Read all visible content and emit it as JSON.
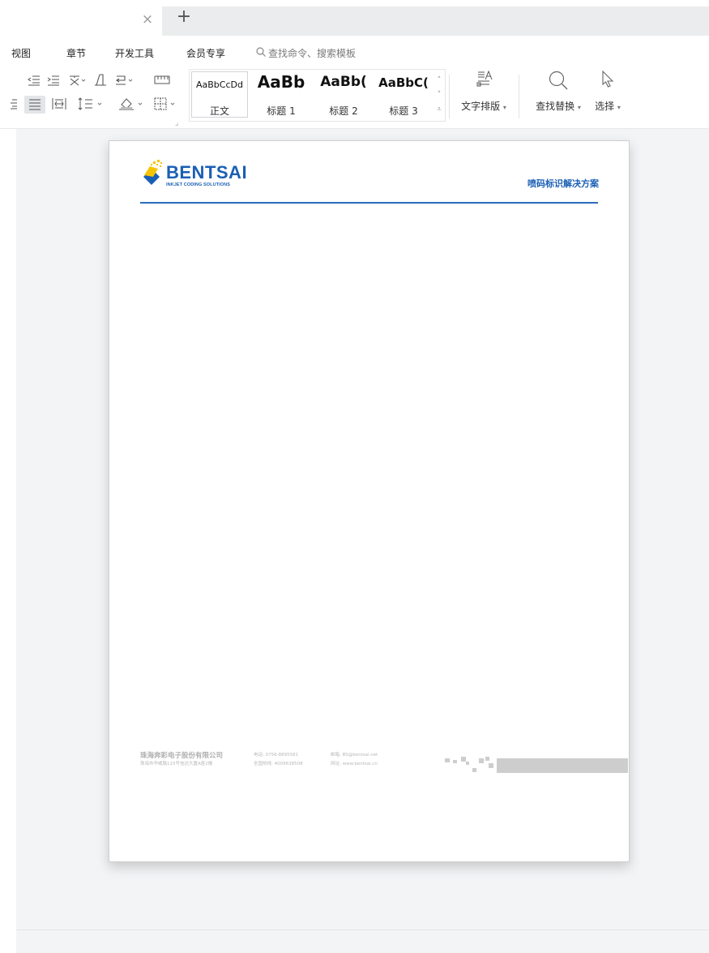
{
  "tabbar": {
    "close_glyph": "×",
    "add_glyph": "+"
  },
  "menu": {
    "items": [
      "视图",
      "章节",
      "开发工具",
      "会员专享"
    ],
    "search_placeholder": "查找命令、搜索模板"
  },
  "ribbon": {
    "style_gallery": [
      {
        "sample": "AaBbCcDd",
        "label": "正文"
      },
      {
        "sample": "AaBb",
        "label": "标题 1"
      },
      {
        "sample": "AaBb(",
        "label": "标题 2"
      },
      {
        "sample": "AaBbC(",
        "label": "标题 3"
      }
    ],
    "text_layout_label": "文字排版",
    "find_replace_label": "查找替换",
    "select_label": "选择",
    "dropdown_glyph": "▾"
  },
  "document": {
    "logo_text": "BENTSAI",
    "logo_tagline": "INKJET CODING SOLUTIONS",
    "header_right": "喷码标识解决方案",
    "footer": {
      "company": "珠海奔彩电子股份有限公司",
      "address": "珠海市华威路115号信达大厦A座2楼",
      "phone": "电话: 0756-8895581",
      "hotline": "全国热线: 4009638508",
      "email": "邮箱: BS@bentsai.net",
      "website": "网址: www.bentsai.cn"
    }
  },
  "colors": {
    "brand_blue": "#1a5fb4",
    "logo_yellow": "#f5c400",
    "workspace_bg": "#f3f4f6",
    "tab_strip_bg": "#ebeced"
  }
}
